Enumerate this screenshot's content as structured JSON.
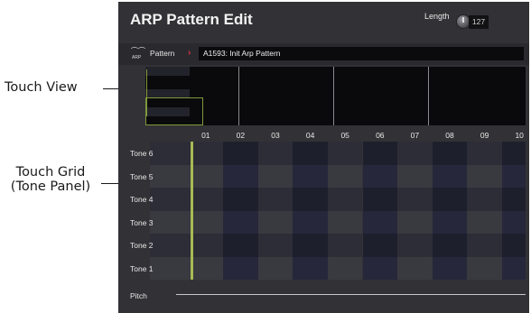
{
  "callouts": {
    "touch_view": "Touch View",
    "touch_grid_line1": "Touch Grid",
    "touch_grid_line2": "(Tone Panel)"
  },
  "header": {
    "title": "ARP Pattern Edit",
    "length_label": "Length",
    "length_value": "127"
  },
  "pattern": {
    "icon": "arp-icon",
    "icon_text": "ARP",
    "label": "Pattern",
    "name": "A1593: Init Arp Pattern"
  },
  "columns": [
    "01",
    "02",
    "03",
    "04",
    "05",
    "06",
    "07",
    "08",
    "09",
    "10"
  ],
  "tones": [
    "Tone 6",
    "Tone 5",
    "Tone 4",
    "Tone 3",
    "Tone 2",
    "Tone 1"
  ],
  "pitch_label": "Pitch",
  "colors": {
    "background": "#323236",
    "grid_dark": "#1e1f2c",
    "grid_mid": "#2c2d36",
    "grid_light": "#393940",
    "playhead": "#a6bb54",
    "accent": "#e0304a"
  }
}
